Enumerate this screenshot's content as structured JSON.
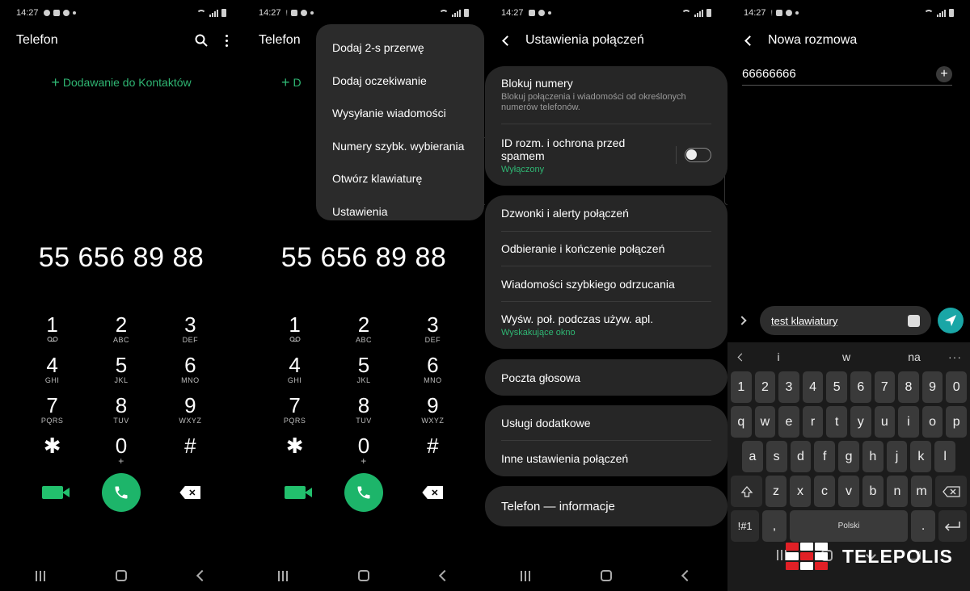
{
  "status": {
    "time": "14:27"
  },
  "dialer": {
    "title": "Telefon",
    "add_contact": "Dodawanie do Kontaktów",
    "add_contact_short": "D",
    "number": "55 656 89 88",
    "keys": [
      {
        "d": "1",
        "s": "voicemail"
      },
      {
        "d": "2",
        "s": "ABC"
      },
      {
        "d": "3",
        "s": "DEF"
      },
      {
        "d": "4",
        "s": "GHI"
      },
      {
        "d": "5",
        "s": "JKL"
      },
      {
        "d": "6",
        "s": "MNO"
      },
      {
        "d": "7",
        "s": "PQRS"
      },
      {
        "d": "8",
        "s": "TUV"
      },
      {
        "d": "9",
        "s": "WXYZ"
      },
      {
        "d": "✱",
        "s": ""
      },
      {
        "d": "0",
        "s": "+"
      },
      {
        "d": "#",
        "s": ""
      }
    ]
  },
  "menu": {
    "items": [
      "Dodaj 2-s przerwę",
      "Dodaj oczekiwanie",
      "Wysyłanie wiadomości",
      "Numery szybk. wybierania",
      "Otwórz klawiaturę",
      "Ustawienia"
    ]
  },
  "settings": {
    "title": "Ustawienia połączeń",
    "block_numbers": "Blokuj numery",
    "block_numbers_sub": "Blokuj połączenia i wiadomości od określonych numerów telefonów.",
    "caller_id": "ID rozm. i ochrona przed spamem",
    "caller_id_status": "Wyłączony",
    "ringtones": "Dzwonki i alerty połączeń",
    "answering": "Odbieranie i kończenie połączeń",
    "quick_decline": "Wiadomości szybkiego odrzucania",
    "popup": "Wyśw. poł. podczas używ. apl.",
    "popup_status": "Wyskakujące okno",
    "voicemail": "Poczta głosowa",
    "supplementary": "Usługi dodatkowe",
    "other": "Inne ustawienia połączeń",
    "about": "Telefon — informacje"
  },
  "message": {
    "title": "Nowa rozmowa",
    "recipient": "66666666",
    "input_text": "test klawiatury",
    "suggestions": [
      "i",
      "w",
      "na"
    ],
    "num_row": [
      "1",
      "2",
      "3",
      "4",
      "5",
      "6",
      "7",
      "8",
      "9",
      "0"
    ],
    "row1": [
      "q",
      "w",
      "e",
      "r",
      "t",
      "y",
      "u",
      "i",
      "o",
      "p"
    ],
    "row2": [
      "a",
      "s",
      "d",
      "f",
      "g",
      "h",
      "j",
      "k",
      "l"
    ],
    "row3": [
      "z",
      "x",
      "c",
      "v",
      "b",
      "n",
      "m"
    ],
    "symbols_key": "!#1",
    "comma_key": ",",
    "space_label": "Polski",
    "period_key": "."
  },
  "watermark": {
    "text": "TELEPOLIS"
  },
  "colors": {
    "accent_green": "#2fb673",
    "call_green": "#1db56a",
    "send_teal": "#1aa6a6",
    "logo_red": "#e22026"
  }
}
